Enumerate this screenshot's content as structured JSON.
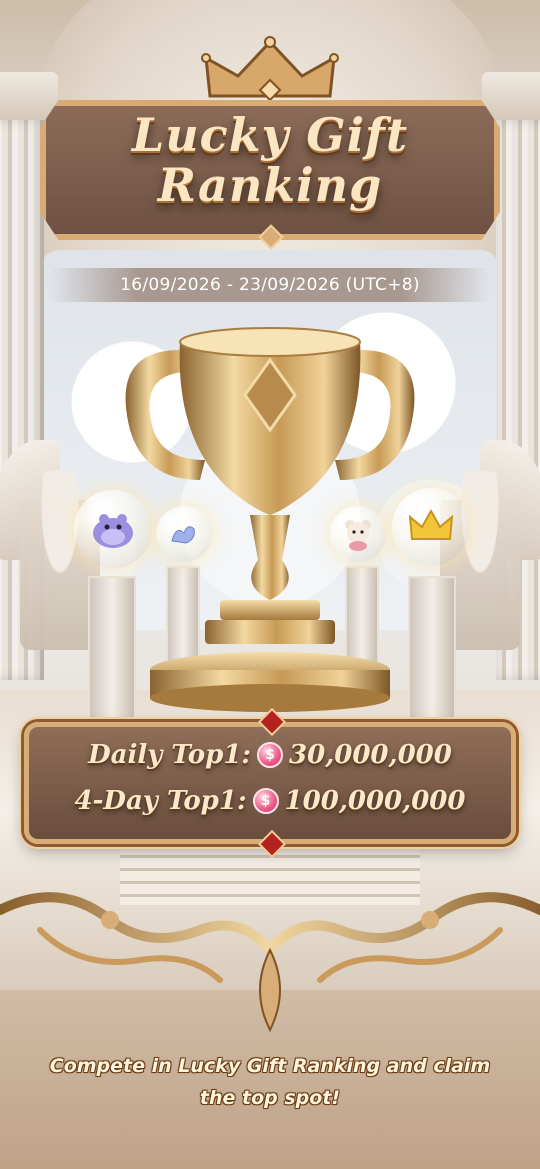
{
  "title": {
    "line1": "Lucky Gift",
    "line2": "Ranking"
  },
  "date_range": "16/09/2026 - 23/09/2026 (UTC+8)",
  "rewards": [
    {
      "label": "Daily Top1:",
      "amount": "30,000,000",
      "icon": "pink-coin-icon"
    },
    {
      "label": "4-Day Top1:",
      "amount": "100,000,000",
      "icon": "pink-coin-icon"
    }
  ],
  "coin_symbol": "$",
  "footer": "Compete in Lucky Gift Ranking and claim the top spot!",
  "gift_orbs": [
    "hippo-gift-icon",
    "swan-gift-icon",
    "teddy-bear-gift-icon",
    "crown-gift-icon"
  ],
  "colors": {
    "gold": "#d9ad77",
    "plate_brown": "#7a5b49",
    "title_text": "#fbe6c4",
    "coin_pink": "#ea5b86"
  }
}
